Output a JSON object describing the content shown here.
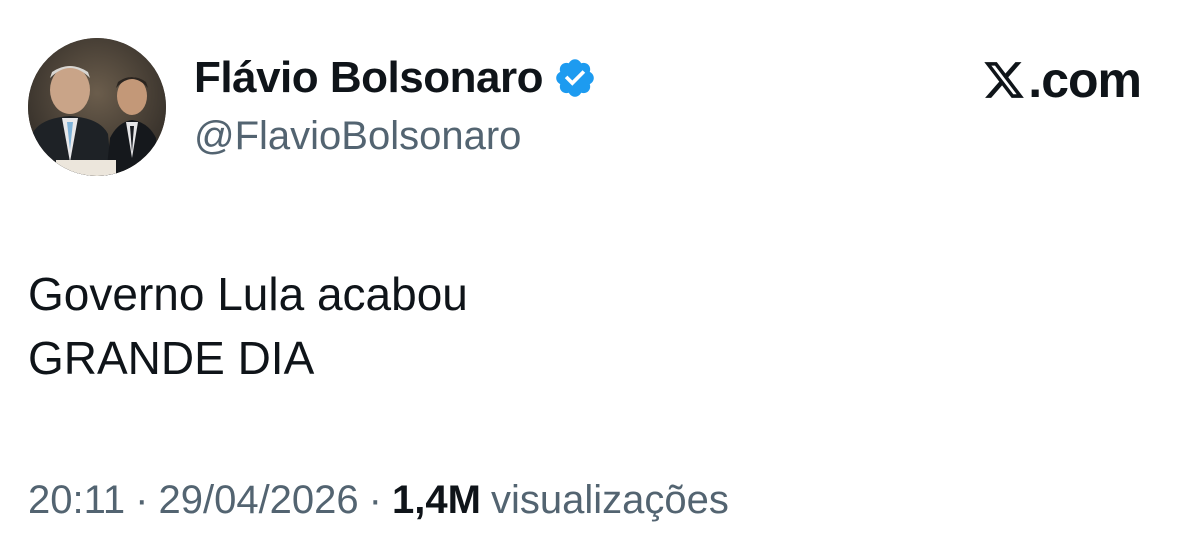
{
  "author": {
    "display_name": "Flávio Bolsonaro",
    "handle": "@FlavioBolsonaro",
    "verified": true,
    "verified_color": "#1d9bf0"
  },
  "brand": {
    "icon": "x-logo-icon",
    "label": ".com"
  },
  "tweet": {
    "lines": [
      "Governo Lula acabou",
      "GRANDE DIA"
    ]
  },
  "meta": {
    "time": "20:11",
    "separator": "·",
    "date": "29/04/2026",
    "views_count": "1,4M",
    "views_label": "visualizações"
  },
  "colors": {
    "text_primary": "#0f1419",
    "text_secondary": "#536471",
    "background": "#ffffff"
  }
}
